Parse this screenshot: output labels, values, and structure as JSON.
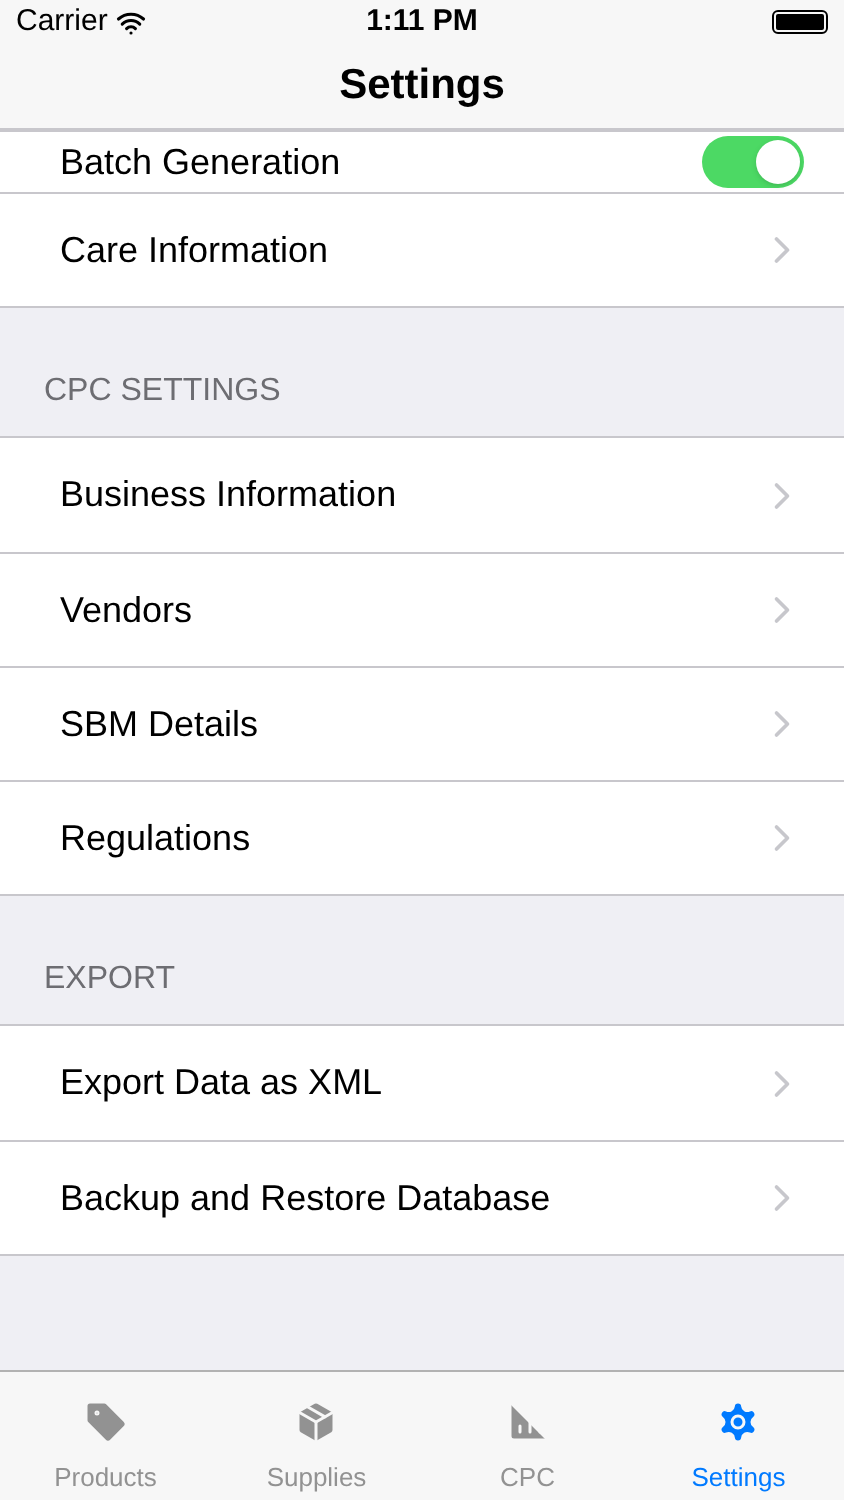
{
  "status_bar": {
    "carrier": "Carrier",
    "time": "1:11 PM"
  },
  "nav": {
    "title": "Settings"
  },
  "sections": [
    {
      "rows": [
        {
          "kind": "toggle",
          "label": "Batch Generation",
          "on": true
        },
        {
          "kind": "link",
          "label": "Care Information"
        }
      ]
    },
    {
      "header": "CPC SETTINGS",
      "rows": [
        {
          "kind": "link",
          "label": "Business Information"
        },
        {
          "kind": "link",
          "label": "Vendors"
        },
        {
          "kind": "link",
          "label": "SBM Details"
        },
        {
          "kind": "link",
          "label": "Regulations"
        }
      ]
    },
    {
      "header": "EXPORT",
      "rows": [
        {
          "kind": "link",
          "label": "Export Data as XML"
        },
        {
          "kind": "link",
          "label": "Backup and Restore Database"
        }
      ]
    }
  ],
  "tabs": [
    {
      "label": "Products",
      "kind": "tag",
      "selected": false
    },
    {
      "label": "Supplies",
      "kind": "box",
      "selected": false
    },
    {
      "label": "CPC",
      "kind": "chart",
      "selected": false
    },
    {
      "label": "Settings",
      "kind": "gear",
      "selected": true
    }
  ]
}
